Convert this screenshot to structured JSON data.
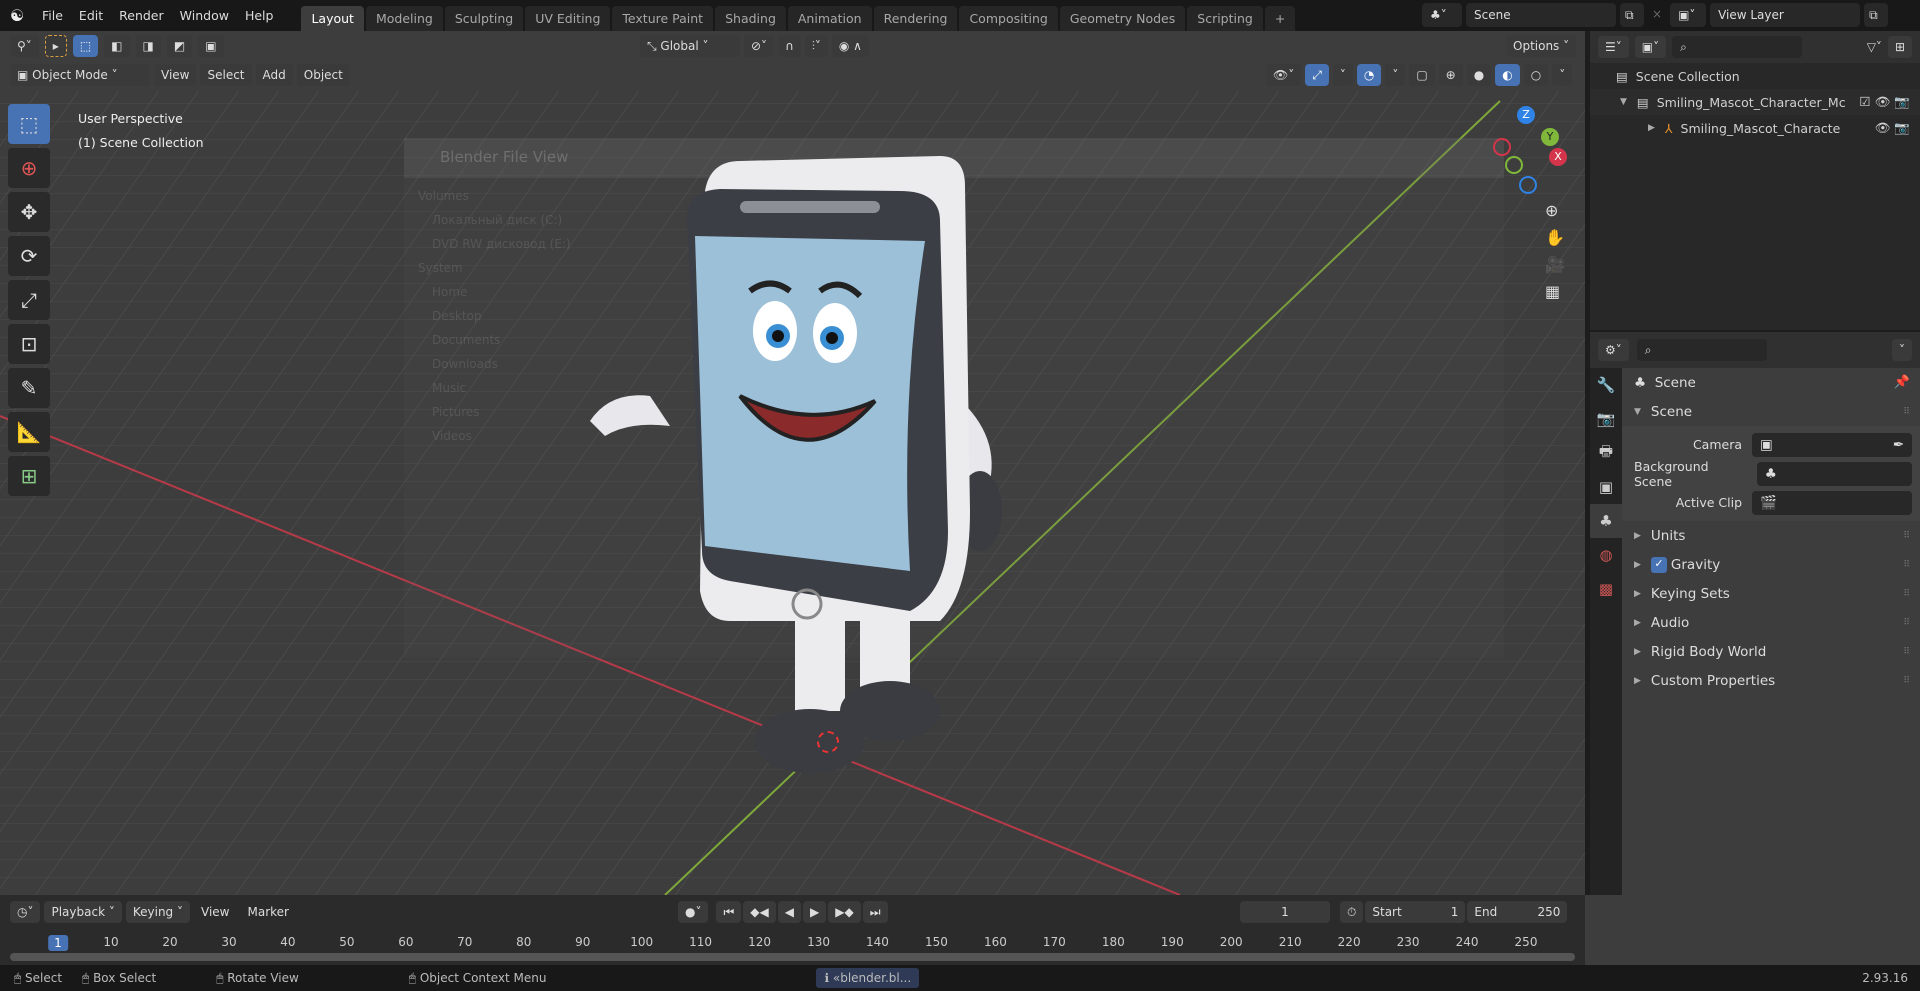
{
  "menu": [
    "File",
    "Edit",
    "Render",
    "Window",
    "Help"
  ],
  "workspaces": [
    "Layout",
    "Modeling",
    "Sculpting",
    "UV Editing",
    "Texture Paint",
    "Shading",
    "Animation",
    "Rendering",
    "Compositing",
    "Geometry Nodes",
    "Scripting"
  ],
  "add_tab": "+",
  "scene_field": "Scene",
  "view_layer_field": "View Layer",
  "viewport": {
    "mode": "Object Mode",
    "menus": [
      "View",
      "Select",
      "Add",
      "Object"
    ],
    "transform_orientation": "Global",
    "options": "Options",
    "overlay_title": "User Perspective",
    "overlay_collection": "(1) Scene Collection",
    "ghost_title": "Blender File View",
    "ghost_items": [
      "Volumes",
      "Локальный диск (C:)",
      "DVD RW дисковод (E:)",
      "System",
      "Home",
      "Desktop",
      "Documents",
      "Downloads",
      "Music",
      "Pictures",
      "Videos"
    ],
    "gizmo": {
      "z": "Z",
      "y": "Y",
      "x": "X"
    }
  },
  "outliner": {
    "root": "Scene Collection",
    "items": [
      {
        "label": "Smiling_Mascot_Character_Mc"
      },
      {
        "label": "Smiling_Mascot_Characte"
      }
    ]
  },
  "properties": {
    "header": "Scene",
    "panel": "Scene",
    "fields": [
      {
        "label": "Camera"
      },
      {
        "label": "Background Scene"
      },
      {
        "label": "Active Clip"
      }
    ],
    "sections": [
      "Units",
      "Gravity",
      "Keying Sets",
      "Audio",
      "Rigid Body World",
      "Custom Properties"
    ],
    "gravity_checked": true
  },
  "timeline": {
    "menus": [
      "Playback",
      "Keying",
      "View",
      "Marker"
    ],
    "current_frame": "1",
    "start_label": "Start",
    "start": "1",
    "end_label": "End",
    "end": "250",
    "ticks": [
      "1",
      "10",
      "20",
      "30",
      "40",
      "50",
      "60",
      "70",
      "80",
      "90",
      "100",
      "110",
      "120",
      "130",
      "140",
      "150",
      "160",
      "170",
      "180",
      "190",
      "200",
      "210",
      "220",
      "230",
      "240",
      "250"
    ]
  },
  "status": {
    "select": "Select",
    "box_select": "Box Select",
    "rotate": "Rotate View",
    "context": "Object Context Menu",
    "report": "«blender.bl...",
    "version": "2.93.16"
  },
  "colors": {
    "accent": "#4772b3",
    "x_axis": "#c0394b",
    "y_axis": "#7fb83a",
    "z_axis": "#2f82e6"
  }
}
